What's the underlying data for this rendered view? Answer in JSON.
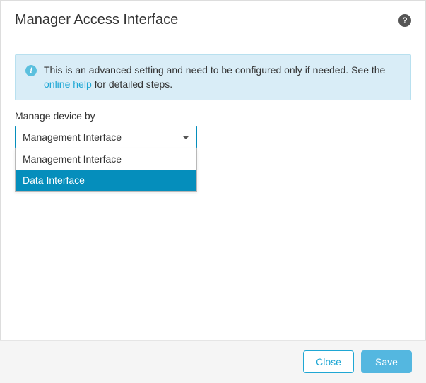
{
  "header": {
    "title": "Manager Access Interface",
    "help_glyph": "?"
  },
  "info": {
    "icon_glyph": "i",
    "text_line": "This is an advanced setting and need to be configured only if needed. See the ",
    "link_text": "online help",
    "text_after": " for detailed steps."
  },
  "field": {
    "label": "Manage device by",
    "selected": "Management Interface",
    "options": [
      {
        "label": "Management Interface",
        "highlighted": false
      },
      {
        "label": "Data Interface",
        "highlighted": true
      }
    ]
  },
  "footer": {
    "close_label": "Close",
    "save_label": "Save"
  }
}
